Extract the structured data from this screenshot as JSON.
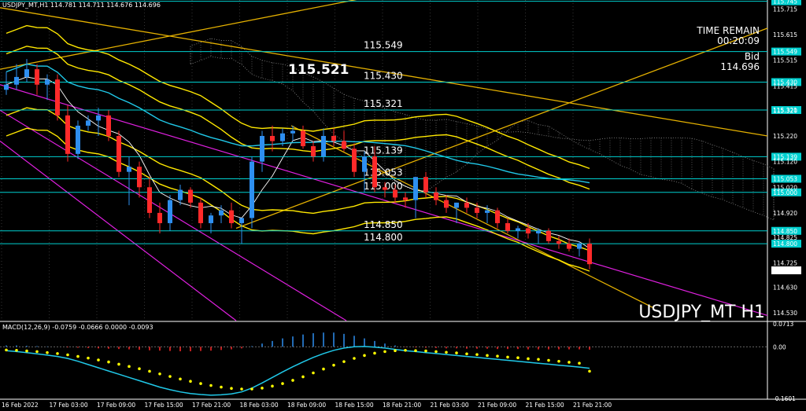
{
  "header": {
    "symbol_line": "USDJPY_MT,H1  114.781 114.711 114.676 114.696",
    "time_remain_label": "TIME REMAIN",
    "time_remain_value": "00:20:09",
    "bid_label": "Bid",
    "bid_value": "114.696",
    "symbol_watermark": "USDJPY_MT H1",
    "highlight_level": "115.521"
  },
  "colors": {
    "background": "#000000",
    "bull_candle": "#2e8ff0",
    "bear_candle": "#ff2a2a",
    "level_line": "#00d0d0",
    "channel": "#e020e0",
    "bands": "#ffe800",
    "trend": "#e5b100",
    "cloud": "#8a8a8a",
    "macd_line": "#20c8e8",
    "signal": "#ffff00"
  },
  "chart_data": [
    {
      "type": "candlestick",
      "symbol": "USDJPY_MT",
      "timeframe": "H1",
      "ylim": [
        114.5,
        115.75
      ],
      "y_ticks": [
        "115.715",
        "115.615",
        "115.515",
        "115.415",
        "115.320",
        "115.220",
        "115.120",
        "115.020",
        "114.920",
        "114.825",
        "114.725",
        "114.630",
        "114.530"
      ],
      "x_ticks": [
        "16 Feb 2022",
        "17 Feb 03:00",
        "17 Feb 09:00",
        "17 Feb 15:00",
        "17 Feb 21:00",
        "18 Feb 03:00",
        "18 Feb 09:00",
        "18 Feb 15:00",
        "18 Feb 21:00",
        "21 Feb 03:00",
        "21 Feb 09:00",
        "21 Feb 15:00",
        "21 Feb 21:00"
      ],
      "ohlc": [
        [
          115.4,
          115.47,
          115.38,
          115.42
        ],
        [
          115.42,
          115.5,
          115.4,
          115.45
        ],
        [
          115.45,
          115.52,
          115.43,
          115.48
        ],
        [
          115.48,
          115.5,
          115.38,
          115.42
        ],
        [
          115.42,
          115.46,
          115.36,
          115.44
        ],
        [
          115.44,
          115.46,
          115.28,
          115.3
        ],
        [
          115.3,
          115.34,
          115.12,
          115.15
        ],
        [
          115.15,
          115.28,
          115.13,
          115.26
        ],
        [
          115.26,
          115.3,
          115.24,
          115.28
        ],
        [
          115.28,
          115.33,
          115.22,
          115.3
        ],
        [
          115.3,
          115.32,
          115.2,
          115.22
        ],
        [
          115.22,
          115.24,
          115.06,
          115.08
        ],
        [
          115.08,
          115.14,
          114.95,
          115.1
        ],
        [
          115.1,
          115.12,
          114.98,
          115.02
        ],
        [
          115.02,
          115.06,
          114.9,
          114.92
        ],
        [
          114.92,
          114.96,
          114.84,
          114.88
        ],
        [
          114.88,
          114.99,
          114.85,
          114.97
        ],
        [
          114.97,
          115.03,
          114.95,
          115.01
        ],
        [
          115.01,
          115.02,
          114.94,
          114.96
        ],
        [
          114.96,
          114.98,
          114.86,
          114.88
        ],
        [
          114.88,
          114.92,
          114.84,
          114.91
        ],
        [
          114.91,
          114.95,
          114.88,
          114.93
        ],
        [
          114.93,
          114.96,
          114.86,
          114.88
        ],
        [
          114.88,
          114.9,
          114.8,
          114.9
        ],
        [
          114.9,
          115.14,
          114.86,
          115.12
        ],
        [
          115.12,
          115.24,
          115.08,
          115.22
        ],
        [
          115.22,
          115.26,
          115.16,
          115.2
        ],
        [
          115.2,
          115.25,
          115.18,
          115.23
        ],
        [
          115.23,
          115.26,
          115.2,
          115.24
        ],
        [
          115.24,
          115.26,
          115.17,
          115.18
        ],
        [
          115.18,
          115.2,
          115.12,
          115.14
        ],
        [
          115.14,
          115.25,
          115.12,
          115.22
        ],
        [
          115.22,
          115.25,
          115.18,
          115.2
        ],
        [
          115.2,
          115.24,
          115.16,
          115.17
        ],
        [
          115.17,
          115.19,
          115.06,
          115.08
        ],
        [
          115.08,
          115.16,
          115.0,
          115.14
        ],
        [
          115.14,
          115.18,
          115.0,
          115.02
        ],
        [
          115.02,
          115.04,
          114.98,
          115.01
        ],
        [
          115.01,
          115.03,
          114.96,
          114.98
        ],
        [
          114.98,
          115.0,
          114.94,
          114.97
        ],
        [
          114.97,
          115.02,
          114.9,
          115.06
        ],
        [
          115.06,
          115.08,
          114.98,
          115.0
        ],
        [
          115.0,
          115.02,
          114.95,
          114.97
        ],
        [
          114.97,
          114.99,
          114.92,
          114.94
        ],
        [
          114.94,
          114.96,
          114.88,
          114.96
        ],
        [
          114.96,
          114.98,
          114.92,
          114.94
        ],
        [
          114.94,
          114.96,
          114.9,
          114.92
        ],
        [
          114.92,
          114.95,
          114.88,
          114.93
        ],
        [
          114.93,
          114.94,
          114.86,
          114.88
        ],
        [
          114.88,
          114.9,
          114.84,
          114.85
        ],
        [
          114.85,
          114.87,
          114.82,
          114.86
        ],
        [
          114.86,
          114.88,
          114.82,
          114.84
        ],
        [
          114.84,
          114.86,
          114.8,
          114.85
        ],
        [
          114.85,
          114.86,
          114.8,
          114.81
        ],
        [
          114.81,
          114.83,
          114.78,
          114.8
        ],
        [
          114.8,
          114.82,
          114.77,
          114.78
        ],
        [
          114.78,
          114.81,
          114.75,
          114.8
        ],
        [
          114.8,
          114.82,
          114.7,
          114.72
        ]
      ],
      "levels": [
        115.745,
        115.549,
        115.43,
        115.321,
        115.139,
        115.053,
        115.0,
        114.85,
        114.8
      ],
      "level_captions": [
        "115.549",
        "115.430",
        "115.321",
        "115.139",
        "115.053",
        "115.000",
        "114.850",
        "114.800"
      ],
      "price_tags": [
        "115.745",
        "115.549",
        "115.430",
        "115.321",
        "115.139",
        "115.053",
        "115.000",
        "114.850",
        "114.800",
        "114.696"
      ]
    },
    {
      "type": "line",
      "title": "MACD(12,26,9) -0.0759 -0.0666 0.0000 -0.0093",
      "ylim": [
        -0.1601,
        0.0713
      ],
      "y_ticks": [
        "0.0713",
        "0.00",
        "-0.1601"
      ],
      "histogram": [
        0.004,
        0.004,
        0.003,
        0.002,
        0.001,
        0.0,
        -0.002,
        -0.003,
        -0.004,
        -0.005,
        -0.006,
        -0.007,
        -0.008,
        -0.009,
        -0.011,
        -0.012,
        -0.013,
        -0.014,
        -0.014,
        -0.013,
        -0.012,
        -0.01,
        -0.008,
        -0.005,
        0.002,
        0.01,
        0.018,
        0.026,
        0.032,
        0.038,
        0.042,
        0.044,
        0.044,
        0.04,
        0.034,
        0.026,
        0.018,
        0.01,
        0.004,
        -0.001,
        -0.002,
        -0.003,
        -0.004,
        -0.005,
        -0.005,
        -0.006,
        -0.006,
        -0.006,
        -0.007,
        -0.007,
        -0.007,
        -0.008,
        -0.008,
        -0.008,
        -0.008,
        -0.008,
        -0.008,
        -0.009
      ],
      "macd": [
        -0.012,
        -0.015,
        -0.018,
        -0.022,
        -0.026,
        -0.03,
        -0.036,
        -0.045,
        -0.055,
        -0.065,
        -0.075,
        -0.085,
        -0.095,
        -0.105,
        -0.115,
        -0.125,
        -0.133,
        -0.14,
        -0.145,
        -0.148,
        -0.15,
        -0.149,
        -0.146,
        -0.14,
        -0.128,
        -0.112,
        -0.095,
        -0.078,
        -0.062,
        -0.047,
        -0.033,
        -0.021,
        -0.011,
        -0.004,
        0.0,
        0.001,
        -0.001,
        -0.004,
        -0.008,
        -0.012,
        -0.015,
        -0.018,
        -0.021,
        -0.024,
        -0.027,
        -0.03,
        -0.033,
        -0.036,
        -0.039,
        -0.042,
        -0.045,
        -0.048,
        -0.051,
        -0.054,
        -0.057,
        -0.06,
        -0.063,
        -0.0666
      ],
      "signal": [
        -0.01,
        -0.011,
        -0.013,
        -0.015,
        -0.018,
        -0.021,
        -0.025,
        -0.03,
        -0.035,
        -0.041,
        -0.047,
        -0.054,
        -0.061,
        -0.068,
        -0.076,
        -0.084,
        -0.092,
        -0.1,
        -0.107,
        -0.114,
        -0.12,
        -0.125,
        -0.129,
        -0.131,
        -0.131,
        -0.128,
        -0.122,
        -0.114,
        -0.104,
        -0.093,
        -0.081,
        -0.069,
        -0.057,
        -0.046,
        -0.036,
        -0.027,
        -0.02,
        -0.015,
        -0.012,
        -0.011,
        -0.012,
        -0.013,
        -0.015,
        -0.017,
        -0.019,
        -0.022,
        -0.024,
        -0.027,
        -0.029,
        -0.032,
        -0.034,
        -0.037,
        -0.039,
        -0.042,
        -0.045,
        -0.048,
        -0.051,
        -0.0759
      ]
    }
  ]
}
